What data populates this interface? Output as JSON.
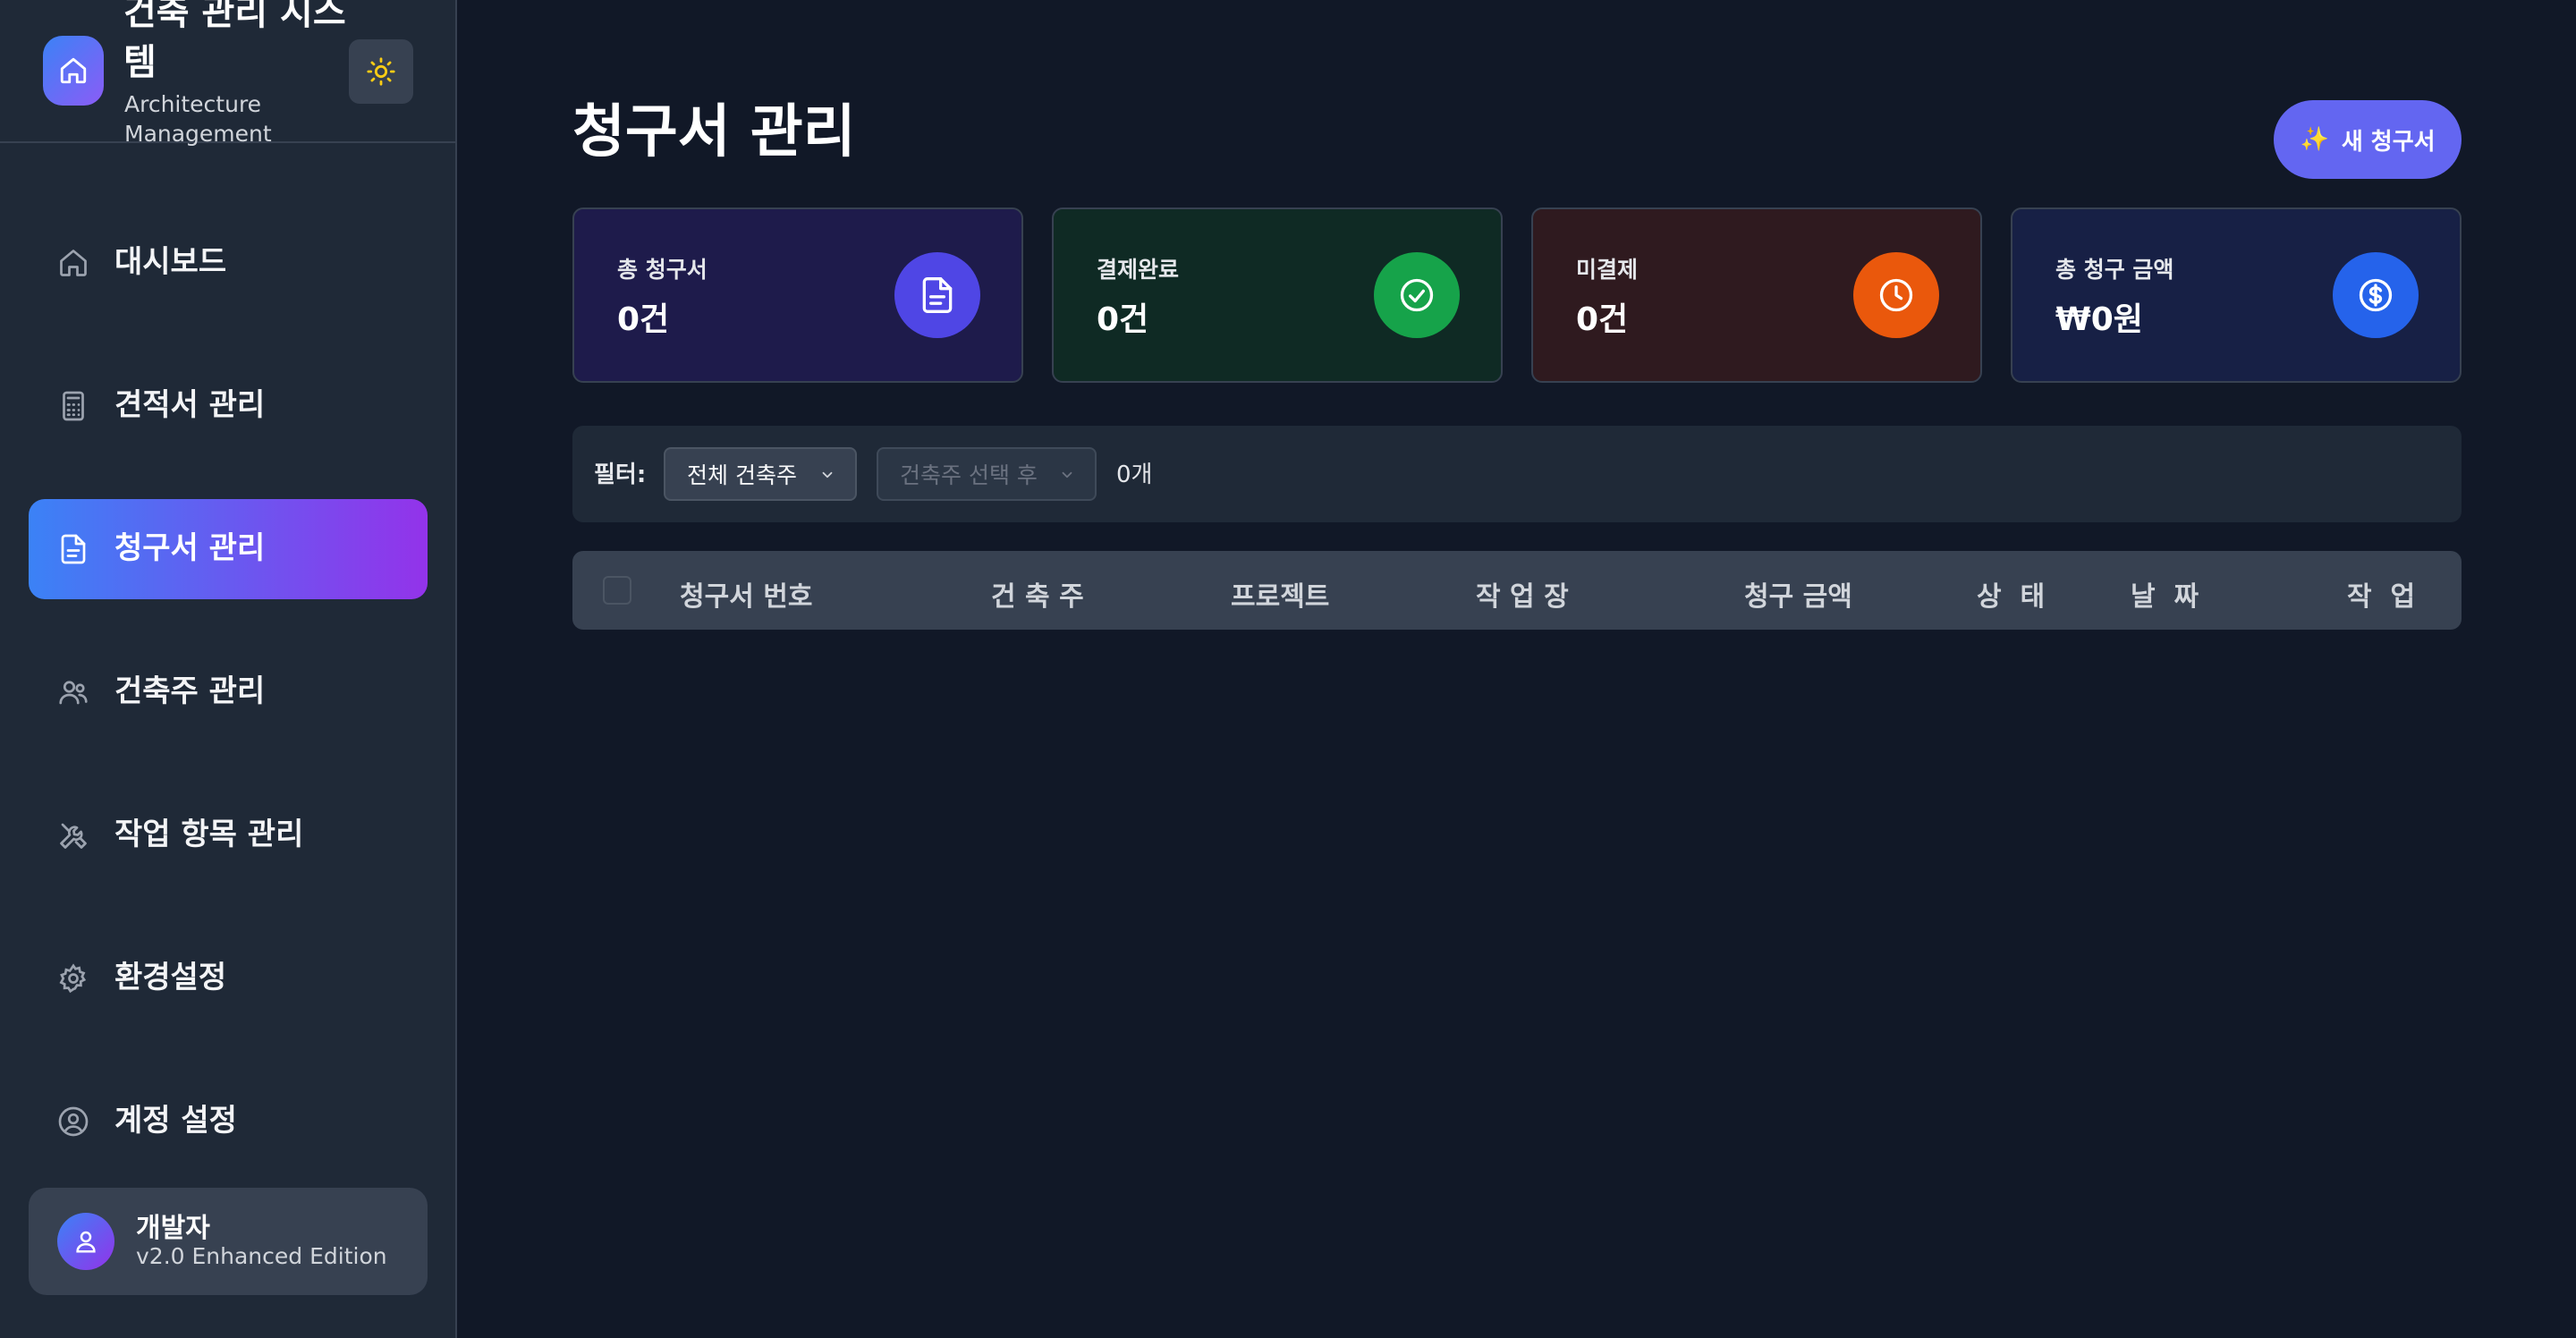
{
  "sidebar": {
    "app_title": "건축 관리 시스템",
    "app_subtitle": "Architecture Management",
    "logo_icon": "home-icon",
    "theme_toggle_icon": "sun-icon",
    "items": [
      {
        "label": "대시보드",
        "icon": "home-icon",
        "active": false
      },
      {
        "label": "견적서 관리",
        "icon": "calculator-icon",
        "active": false
      },
      {
        "label": "청구서 관리",
        "icon": "document-icon",
        "active": true
      },
      {
        "label": "건축주 관리",
        "icon": "users-icon",
        "active": false
      },
      {
        "label": "작업 항목 관리",
        "icon": "tools-icon",
        "active": false
      },
      {
        "label": "환경설정",
        "icon": "gear-icon",
        "active": false
      },
      {
        "label": "계정 설정",
        "icon": "user-circle-icon",
        "active": false
      }
    ],
    "user": {
      "name": "개발자",
      "edition": "v2.0 Enhanced Edition"
    }
  },
  "main": {
    "title": "청구서 관리",
    "new_button": {
      "emoji": "✨",
      "label": "새 청구서"
    },
    "stats": [
      {
        "label": "총 청구서",
        "value": "0건",
        "icon": "document-icon",
        "color": "#4f46e5"
      },
      {
        "label": "결제완료",
        "value": "0건",
        "icon": "check-circle-icon",
        "color": "#16a34a"
      },
      {
        "label": "미결제",
        "value": "0건",
        "icon": "clock-icon",
        "color": "#ea580c"
      },
      {
        "label": "총 청구 금액",
        "value": "₩0원",
        "icon": "dollar-circle-icon",
        "color": "#2563eb"
      }
    ],
    "filter": {
      "label": "필터:",
      "client_select": "전체 건축주",
      "project_select_placeholder": "건축주 선택 후",
      "count": "0개"
    },
    "table": {
      "columns": [
        "청구서 번호",
        "건 축 주",
        "프로젝트",
        "작 업 장",
        "청구 금액",
        "상  태",
        "날  짜",
        "작  업"
      ],
      "rows": []
    }
  },
  "colors": {
    "background": "#111827",
    "sidebar": "#1f2937",
    "accent_gradient_start": "#3b82f6",
    "accent_gradient_end": "#9333ea",
    "primary_button": "#6366f1"
  }
}
